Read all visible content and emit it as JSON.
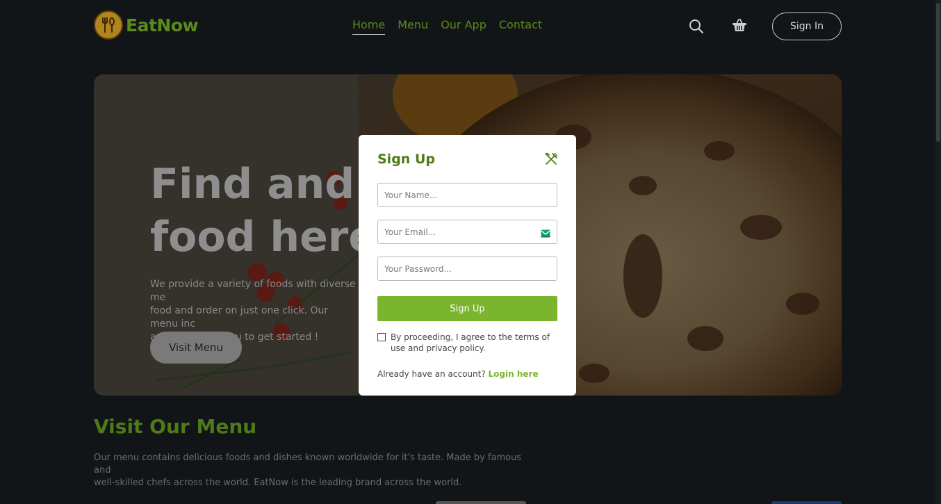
{
  "brand": {
    "name": "EatNow"
  },
  "nav": {
    "items": [
      {
        "label": "Home",
        "active": true
      },
      {
        "label": "Menu",
        "active": false
      },
      {
        "label": "Our App",
        "active": false
      },
      {
        "label": "Contact",
        "active": false
      }
    ]
  },
  "header": {
    "search_icon": "search-icon",
    "cart_icon": "basket-icon",
    "signin_label": "Sign In"
  },
  "hero": {
    "title": "Find and or\nfood here.",
    "description": "We provide a variety of foods with diverse me\nfood and order on just one click. Our menu inc\nand visit our menu to get started !",
    "cta_label": "Visit Menu"
  },
  "menu_section": {
    "title": "Visit Our Menu",
    "description": "Our menu contains delicious foods and dishes known worldwide for it's taste. Made by famous and\nwell-skilled chefs across the world. EatNow is the leading brand across the world."
  },
  "signup_modal": {
    "title": "Sign Up",
    "close_icon": "fork-knife-cross-icon",
    "name_placeholder": "Your Name...",
    "email_placeholder": "Your Email...",
    "password_placeholder": "Your Password...",
    "submit_label": "Sign Up",
    "terms_text": "By proceeding, I agree to the terms of use and privacy policy.",
    "terms_checked": false,
    "login_prompt": "Already have an account?",
    "login_link": "Login here"
  },
  "colors": {
    "brand_green": "#5a8a1c",
    "accent_green": "#7bb52e",
    "background": "#121518",
    "logo_gold": "#b0841e"
  }
}
